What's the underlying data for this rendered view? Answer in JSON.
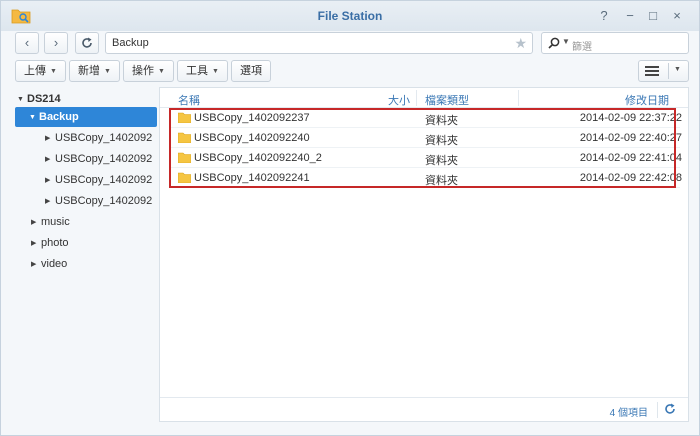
{
  "window": {
    "title": "File Station",
    "controls": {
      "help": "?",
      "minimize": "−",
      "maximize": "□",
      "close": "×"
    }
  },
  "navbar": {
    "back_icon": "‹",
    "forward_icon": "›",
    "path": "Backup",
    "search_placeholder": "篩選"
  },
  "toolbar": {
    "upload_label": "上傳",
    "create_label": "新增",
    "action_label": "操作",
    "tools_label": "工具",
    "settings_label": "選項"
  },
  "sidebar": {
    "root_label": "DS214",
    "selected_label": "Backup",
    "items": [
      {
        "label": "USBCopy_1402092"
      },
      {
        "label": "USBCopy_1402092"
      },
      {
        "label": "USBCopy_1402092"
      },
      {
        "label": "USBCopy_1402092"
      },
      {
        "label": "music"
      },
      {
        "label": "photo"
      },
      {
        "label": "video"
      }
    ]
  },
  "file_list": {
    "headers": {
      "name": "名稱",
      "size": "大小",
      "type": "檔案類型",
      "modified": "修改日期"
    },
    "rows": [
      {
        "name": "USBCopy_1402092237",
        "type": "資料夾",
        "modified": "2014-02-09 22:37:22"
      },
      {
        "name": "USBCopy_1402092240",
        "type": "資料夾",
        "modified": "2014-02-09 22:40:27"
      },
      {
        "name": "USBCopy_1402092240_2",
        "type": "資料夾",
        "modified": "2014-02-09 22:41:04"
      },
      {
        "name": "USBCopy_1402092241",
        "type": "資料夾",
        "modified": "2014-02-09 22:42:08"
      }
    ],
    "item_count": "4 個項目"
  },
  "colors": {
    "accent": "#2e86d8",
    "title_blue": "#3a6ea5",
    "highlight_red": "#c62828",
    "folder_yellow": "#f5c542"
  }
}
